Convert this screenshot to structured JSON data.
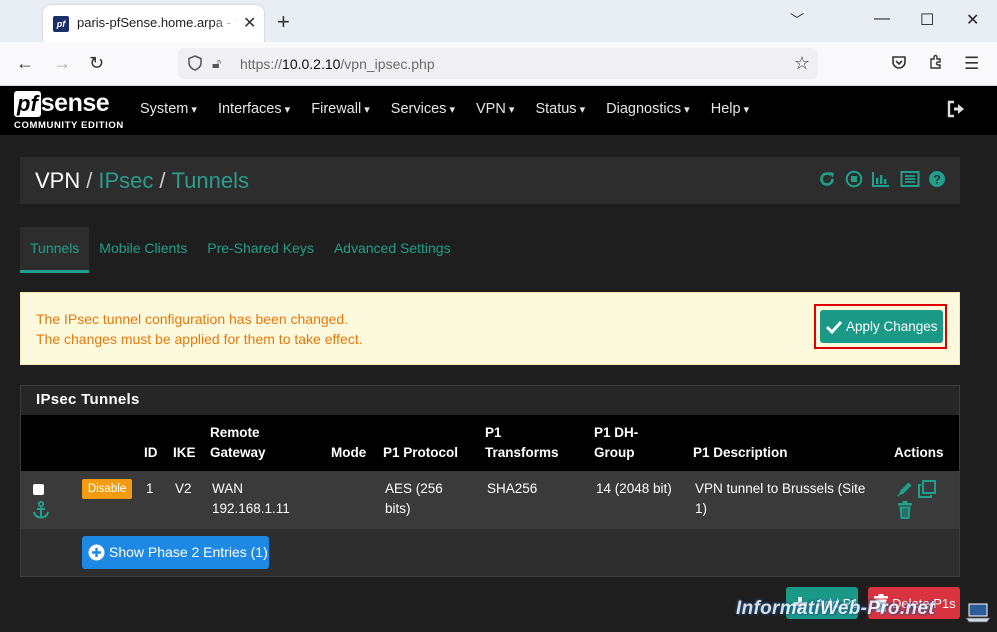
{
  "browser": {
    "tab_title": "paris-pfSense.home.arpa - VPN: IPsec",
    "new_tab": "+",
    "url_prefix": "https://",
    "url_host": "10.0.2.10",
    "url_path": "/vpn_ipsec.php"
  },
  "brand": {
    "logo_pf": "pf",
    "logo_sense": "sense",
    "edition": "COMMUNITY EDITION"
  },
  "menu": [
    "System",
    "Interfaces",
    "Firewall",
    "Services",
    "VPN",
    "Status",
    "Diagnostics",
    "Help"
  ],
  "breadcrumb": {
    "root": "VPN",
    "level1": "IPsec",
    "level2": "Tunnels",
    "sep": "/"
  },
  "tabs": [
    "Tunnels",
    "Mobile Clients",
    "Pre-Shared Keys",
    "Advanced Settings"
  ],
  "alert": {
    "line1": "The IPsec tunnel configuration has been changed.",
    "line2": "The changes must be applied for them to take effect.",
    "apply_label": "Apply Changes"
  },
  "tunnels": {
    "title": "IPsec Tunnels",
    "headers": {
      "id": "ID",
      "ike": "IKE",
      "gateway_1": "Remote",
      "gateway_2": "Gateway",
      "mode": "Mode",
      "protocol": "P1 Protocol",
      "transforms_1": "P1",
      "transforms_2": "Transforms",
      "dh_1": "P1 DH-",
      "dh_2": "Group",
      "description": "P1 Description",
      "actions": "Actions"
    },
    "rows": [
      {
        "status_badge": "Disable",
        "id": "1",
        "ike": "V2",
        "gateway_1": "WAN",
        "gateway_2": "192.168.1.11",
        "mode": "",
        "protocol_1": "AES (256",
        "protocol_2": "bits)",
        "transforms": "SHA256",
        "dh_group": "14 (2048 bit)",
        "description_1": "VPN tunnel to Brussels (Site",
        "description_2": "1)"
      }
    ],
    "show_p2_label": "Show Phase 2 Entries (1)"
  },
  "buttons": {
    "add_p1": "Add P1",
    "delete_p1s": "Delete P1s"
  },
  "watermark": "InformatiWeb-Pro.net",
  "colors": {
    "accent": "#1a9a86",
    "warning_text": "#e8770c",
    "badge_orange": "#f39c12",
    "blue_button": "#1e88e5",
    "danger": "#d9333f",
    "highlight_frame": "#e10000"
  }
}
